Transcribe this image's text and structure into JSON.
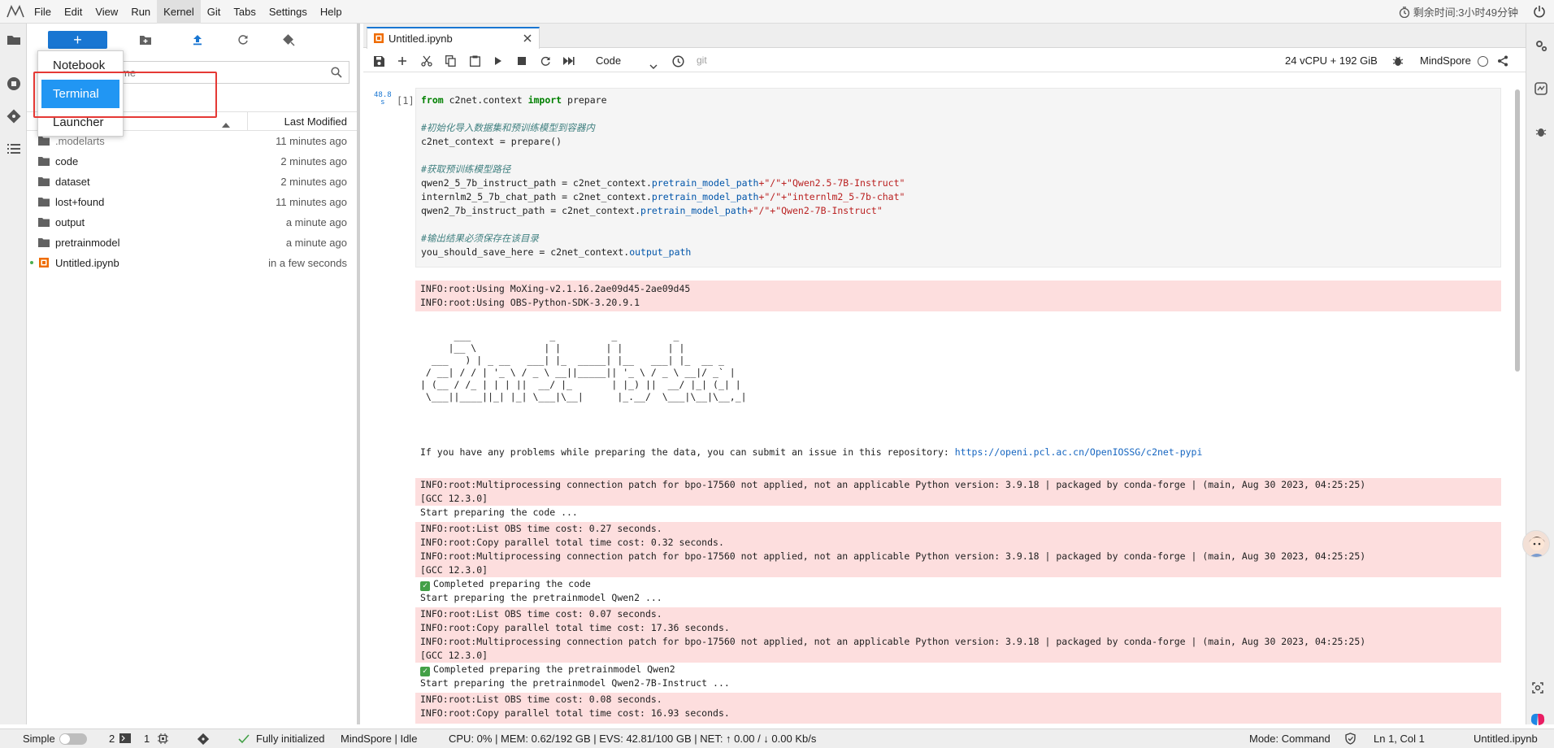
{
  "menubar": {
    "items": [
      "File",
      "Edit",
      "View",
      "Run",
      "Kernel",
      "Git",
      "Tabs",
      "Settings",
      "Help"
    ],
    "active": "Kernel",
    "timer": "剩余时间:3小时49分钟"
  },
  "launcher_menu": {
    "items": [
      "Notebook",
      "Terminal",
      "Launcher"
    ],
    "selected": "Terminal"
  },
  "filebrowser": {
    "search_placeholder": "me",
    "column_modified": "Last Modified",
    "files": [
      {
        "name": ".modelarts",
        "modified": "11 minutes ago",
        "type": "folder"
      },
      {
        "name": "code",
        "modified": "2 minutes ago",
        "type": "folder"
      },
      {
        "name": "dataset",
        "modified": "2 minutes ago",
        "type": "folder"
      },
      {
        "name": "lost+found",
        "modified": "11 minutes ago",
        "type": "folder"
      },
      {
        "name": "output",
        "modified": "a minute ago",
        "type": "folder"
      },
      {
        "name": "pretrainmodel",
        "modified": "a minute ago",
        "type": "folder"
      },
      {
        "name": "Untitled.ipynb",
        "modified": "in a few seconds",
        "type": "notebook"
      }
    ]
  },
  "notebook": {
    "tab_title": "Untitled.ipynb",
    "cell_type": "Code",
    "git_label": "git",
    "resources": "24 vCPU + 192 GiB",
    "kernel": "MindSpore",
    "exec_time": "48.8\ns",
    "prompt": "[1]",
    "code": {
      "l1_kw": "from",
      "l1_mod": " c2net.context ",
      "l1_kw2": "import",
      "l1_rest": " prepare",
      "c1": "#初始化导入数据集和预训练模型到容器内",
      "l2": "c2net_context = prepare()",
      "c2": "#获取预训练模型路径",
      "l3a": "qwen2_5_7b_instruct_path = c2net_context.",
      "l3b": "pretrain_model_path",
      "l3c": "+\"/\"+\"Qwen2.5-7B-Instruct\"",
      "l4a": "internlm2_5_7b_chat_path = c2net_context.",
      "l4b": "pretrain_model_path",
      "l4c": "+\"/\"+\"internlm2_5-7b-chat\"",
      "l5a": "qwen2_7b_instruct_path = c2net_context.",
      "l5b": "pretrain_model_path",
      "l5c": "+\"/\"+\"Qwen2-7B-Instruct\"",
      "c3": "#输出结果必须保存在该目录",
      "l6a": "you_should_save_here = c2net_context.",
      "l6b": "output_path"
    },
    "outputs": {
      "o1": "INFO:root:Using MoXing-v2.1.16.2ae09d45-2ae09d45\nINFO:root:Using OBS-Python-SDK-3.20.9.1",
      "issue_text": "If you have any problems while preparing the data, you can submit an issue in this repository: ",
      "issue_link": "https://openi.pcl.ac.cn/OpenIOSSG/c2net-pypi",
      "o2": "INFO:root:Multiprocessing connection patch for bpo-17560 not applied, not an applicable Python version: 3.9.18 | packaged by conda-forge | (main, Aug 30 2023, 04:25:25)\n[GCC 12.3.0]",
      "o3": "Start preparing the code ...",
      "o4": "INFO:root:List OBS time cost: 0.27 seconds.\nINFO:root:Copy parallel total time cost: 0.32 seconds.\nINFO:root:Multiprocessing connection patch for bpo-17560 not applied, not an applicable Python version: 3.9.18 | packaged by conda-forge | (main, Aug 30 2023, 04:25:25)\n[GCC 12.3.0]",
      "o5": "Completed preparing the code",
      "o6": "Start preparing the pretrainmodel Qwen2 ...",
      "o7": "INFO:root:List OBS time cost: 0.07 seconds.\nINFO:root:Copy parallel total time cost: 17.36 seconds.\nINFO:root:Multiprocessing connection patch for bpo-17560 not applied, not an applicable Python version: 3.9.18 | packaged by conda-forge | (main, Aug 30 2023, 04:25:25)\n[GCC 12.3.0]",
      "o8": "Completed preparing the pretrainmodel Qwen2",
      "o9": "Start preparing the pretrainmodel Qwen2-7B-Instruct ...",
      "o10": "INFO:root:List OBS time cost: 0.08 seconds.\nINFO:root:Copy parallel total time cost: 16.93 seconds."
    }
  },
  "statusbar": {
    "mode": "Simple",
    "terminals": "2",
    "kernels": "1",
    "git_status": "Fully initialized",
    "kernel_status": "MindSpore | Idle",
    "resources": "CPU: 0% | MEM: 0.62/192 GB | EVS: 42.81/100 GB | NET: ↑ 0.00 / ↓ 0.00 Kb/s",
    "command_mode": "Mode: Command",
    "cursor": "Ln 1, Col 1",
    "filename": "Untitled.ipynb"
  },
  "colors": {
    "accent": "#1976d2",
    "error_bg": "#fddede",
    "highlight_box": "#e53935"
  }
}
